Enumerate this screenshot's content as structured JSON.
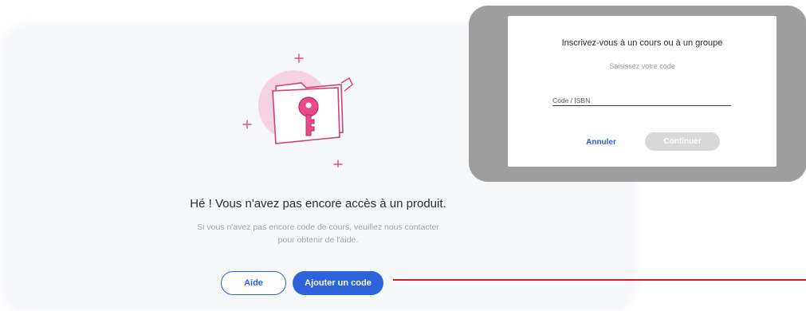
{
  "empty_state": {
    "title": "Hé ! Vous n'avez pas encore accès à un produit.",
    "subtitle_line1": "Si vous n'avez pas encore code de cours, veuillez nous contacter",
    "subtitle_line2": "pour obtenir de l'aide.",
    "illustration": "folder-key-icon",
    "buttons": {
      "help": "Aide",
      "add_code": "Ajouter un code"
    }
  },
  "modal": {
    "title": "Inscrivez-vous à un cours ou à un groupe",
    "subtitle": "Saisissez votre code",
    "input": {
      "label": "Code / ISBN",
      "value": ""
    },
    "cancel": "Annuler",
    "continue": "Continuer",
    "continue_disabled": true
  },
  "colors": {
    "primary": "#2d62d8",
    "accent_pink": "#e84a8a",
    "annotation_red": "#c3202a",
    "modal_backdrop": "#9e9e9e"
  }
}
